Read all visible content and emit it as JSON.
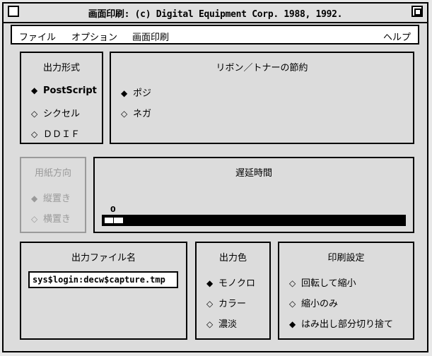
{
  "window": {
    "title": "画面印刷: (c) Digital Equipment Corp. 1988, 1992."
  },
  "menu": {
    "file": "ファイル",
    "options": "オプション",
    "print": "画面印刷",
    "help": "ヘルプ"
  },
  "output_format": {
    "title": "出力形式",
    "options": [
      {
        "label": "PostScript",
        "selected": true,
        "symbol": "◆"
      },
      {
        "label": "シクセル",
        "selected": false,
        "symbol": "◇"
      },
      {
        "label": "ＤＤＩＦ",
        "selected": false,
        "symbol": "◇"
      }
    ]
  },
  "ribbon": {
    "title": "リボン／トナーの節約",
    "options": [
      {
        "label": "ポジ",
        "selected": true,
        "symbol": "◆"
      },
      {
        "label": "ネガ",
        "selected": false,
        "symbol": "◇"
      }
    ]
  },
  "orientation": {
    "title": "用紙方向",
    "disabled": true,
    "options": [
      {
        "label": "縦置き",
        "selected": true,
        "symbol": "◆"
      },
      {
        "label": "横置き",
        "selected": false,
        "symbol": "◇"
      }
    ]
  },
  "delay": {
    "title": "遅延時間",
    "value": "0"
  },
  "output_file": {
    "title": "出力ファイル名",
    "value": "sys$login:decw$capture.tmp"
  },
  "output_color": {
    "title": "出力色",
    "options": [
      {
        "label": "モノクロ",
        "selected": true,
        "symbol": "◆"
      },
      {
        "label": "カラー",
        "selected": false,
        "symbol": "◇"
      },
      {
        "label": "濃淡",
        "selected": false,
        "symbol": "◇"
      }
    ]
  },
  "print_settings": {
    "title": "印刷設定",
    "options": [
      {
        "label": "回転して縮小",
        "selected": false,
        "symbol": "◇"
      },
      {
        "label": "縮小のみ",
        "selected": false,
        "symbol": "◇"
      },
      {
        "label": "はみ出し部分切り捨て",
        "selected": true,
        "symbol": "◆"
      }
    ]
  }
}
